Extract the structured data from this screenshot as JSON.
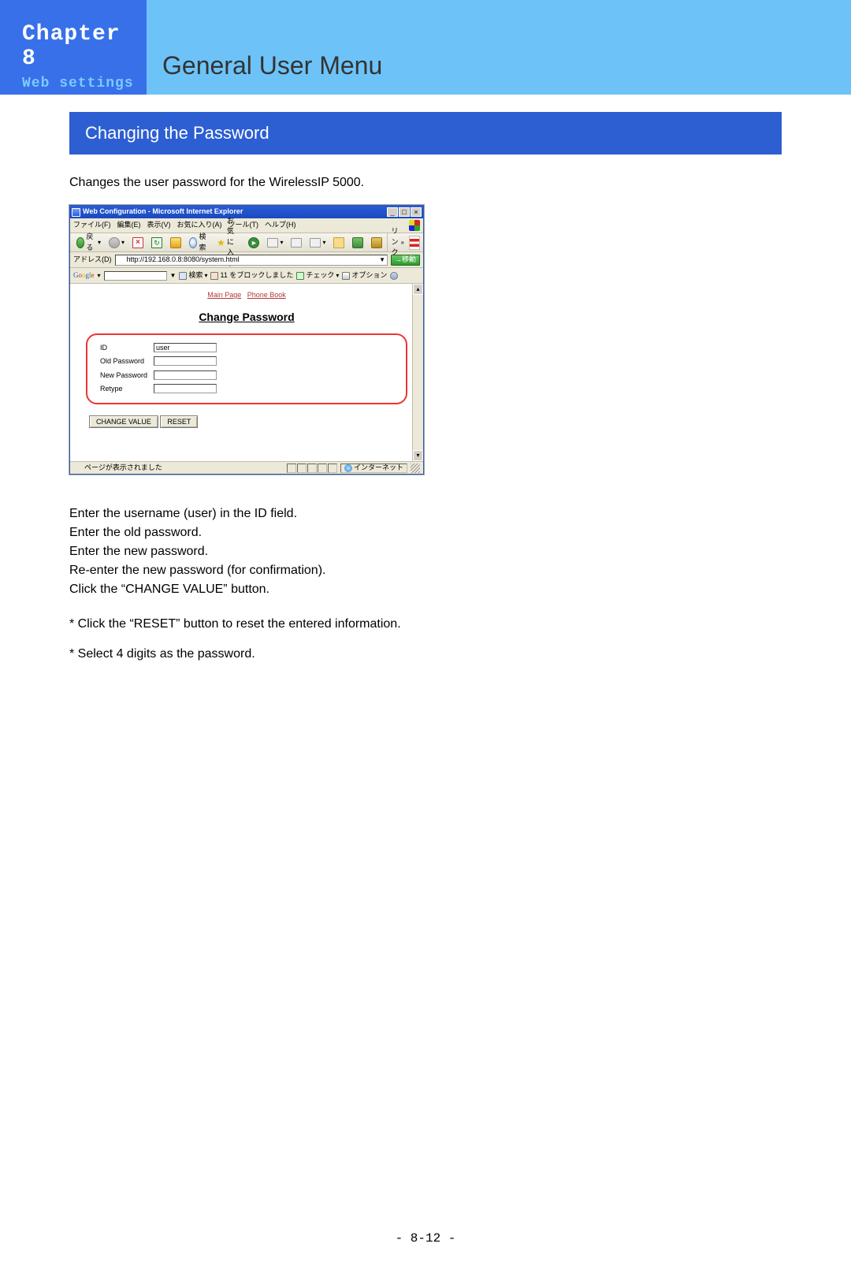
{
  "header": {
    "chapter": "Chapter 8",
    "subtitle": "Web settings",
    "main_title": "General User Menu"
  },
  "section_bar": "Changing the Password",
  "intro": "Changes the user password for the WirelessIP 5000.",
  "ie": {
    "title": "Web Configuration - Microsoft Internet Explorer",
    "menu": {
      "file": "ファイル(F)",
      "edit": "編集(E)",
      "view": "表示(V)",
      "favorites": "お気に入り(A)",
      "tools": "ツール(T)",
      "help": "ヘルプ(H)"
    },
    "toolbar": {
      "back": "戻る",
      "search": "検索",
      "favorites": "お気に入り",
      "links_label": "リンク"
    },
    "addr": {
      "label": "アドレス(D)",
      "url": "http://192.168.0.8:8080/system.html",
      "go": "移動"
    },
    "google": {
      "brand": "Google",
      "search": "検索",
      "blocked": "11 をブロックしました",
      "check": "チェック",
      "options": "オプション"
    },
    "page": {
      "mainpage": "Main Page",
      "phonebook": "Phone Book",
      "heading": "Change Password",
      "labels": {
        "id": "ID",
        "old": "Old Password",
        "newp": "New Password",
        "retype": "Retype"
      },
      "id_value": "user",
      "btn_change": "CHANGE VALUE",
      "btn_reset": "RESET"
    },
    "status": {
      "loaded": "ページが表示されました",
      "zone": "インターネット"
    }
  },
  "instructions": {
    "l1": "Enter the username (user) in the ID field.",
    "l2": "Enter the old password.",
    "l3": "Enter the new password.",
    "l4": "Re-enter the new password (for confirmation).",
    "l5": "Click the “CHANGE VALUE” button.",
    "n1": "* Click the “RESET” button to reset the entered information.",
    "n2": "* Select 4 digits as the password."
  },
  "footer": "- 8-12 -"
}
